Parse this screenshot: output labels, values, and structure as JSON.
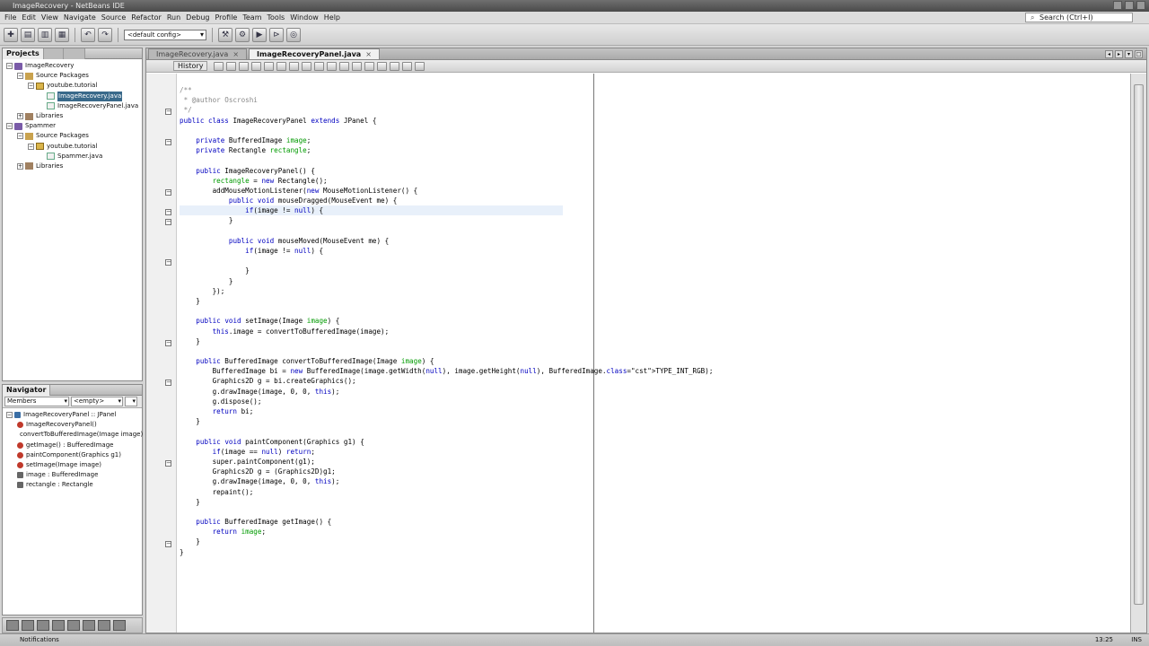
{
  "window": {
    "title": "ImageRecovery - NetBeans IDE"
  },
  "menu": [
    "File",
    "Edit",
    "View",
    "Navigate",
    "Source",
    "Refactor",
    "Run",
    "Debug",
    "Profile",
    "Team",
    "Tools",
    "Window",
    "Help"
  ],
  "search": {
    "placeholder": "Search (Ctrl+I)"
  },
  "toolbar": {
    "config": "<default config>"
  },
  "projects": {
    "tab_label": "Projects",
    "items": [
      {
        "label": "ImageRecovery",
        "type": "project",
        "indent": 0
      },
      {
        "label": "Source Packages",
        "type": "pkgfolder",
        "indent": 1
      },
      {
        "label": "youtube.tutorial",
        "type": "package",
        "indent": 2
      },
      {
        "label": "ImageRecovery.java",
        "type": "java",
        "indent": 3,
        "selected": true
      },
      {
        "label": "ImageRecoveryPanel.java",
        "type": "java",
        "indent": 3
      },
      {
        "label": "Libraries",
        "type": "library",
        "indent": 1
      },
      {
        "label": "Spammer",
        "type": "project",
        "indent": 0
      },
      {
        "label": "Source Packages",
        "type": "pkgfolder",
        "indent": 1
      },
      {
        "label": "youtube.tutorial",
        "type": "package",
        "indent": 2
      },
      {
        "label": "Spammer.java",
        "type": "java",
        "indent": 3
      },
      {
        "label": "Libraries",
        "type": "library",
        "indent": 1
      }
    ]
  },
  "navigator": {
    "tab_label": "Navigator",
    "filter1": "Members",
    "filter2": "<empty>",
    "items": [
      {
        "label": "ImageRecoveryPanel :: JPanel",
        "kind": "class",
        "indent": 0
      },
      {
        "label": "ImageRecoveryPanel()",
        "kind": "method",
        "indent": 1
      },
      {
        "label": "convertToBufferedImage(Image image)",
        "kind": "method",
        "indent": 1
      },
      {
        "label": "getImage() : BufferedImage",
        "kind": "method",
        "indent": 1
      },
      {
        "label": "paintComponent(Graphics g1)",
        "kind": "method",
        "indent": 1
      },
      {
        "label": "setImage(Image image)",
        "kind": "method",
        "indent": 1
      },
      {
        "label": "image : BufferedImage",
        "kind": "field",
        "indent": 1
      },
      {
        "label": "rectangle : Rectangle",
        "kind": "field",
        "indent": 1
      }
    ]
  },
  "editor": {
    "tabs": [
      {
        "label": "ImageRecovery.java",
        "active": false
      },
      {
        "label": "ImageRecoveryPanel.java",
        "active": true
      }
    ],
    "history_label": "History",
    "code_lines": [
      "/**",
      " * @author Oscroshi",
      " */",
      "public class ImageRecoveryPanel extends JPanel {",
      "",
      "    private BufferedImage image;",
      "    private Rectangle rectangle;",
      "",
      "    public ImageRecoveryPanel() {",
      "        rectangle = new Rectangle();",
      "        addMouseMotionListener(new MouseMotionListener() {",
      "            public void mouseDragged(MouseEvent me) {",
      "                if(image != null) {",
      "            }",
      "",
      "            public void mouseMoved(MouseEvent me) {",
      "                if(image != null) {",
      "",
      "                }",
      "            }",
      "        });",
      "    }",
      "",
      "    public void setImage(Image image) {",
      "        this.image = convertToBufferedImage(image);",
      "    }",
      "",
      "    public BufferedImage convertToBufferedImage(Image image) {",
      "        BufferedImage bi = new BufferedImage(image.getWidth(null), image.getHeight(null), BufferedImage.TYPE_INT_RGB);",
      "        Graphics2D g = bi.createGraphics();",
      "        g.drawImage(image, 0, 0, this);",
      "        g.dispose();",
      "        return bi;",
      "    }",
      "",
      "    public void paintComponent(Graphics g1) {",
      "        if(image == null) return;",
      "        super.paintComponent(g1);",
      "        Graphics2D g = (Graphics2D)g1;",
      "        g.drawImage(image, 0, 0, this);",
      "        repaint();",
      "    }",
      "",
      "    public BufferedImage getImage() {",
      "        return image;",
      "    }",
      "}"
    ],
    "current_line": 13
  },
  "status": {
    "notifications": "Notifications",
    "position": "13:25",
    "insert_mode": "INS"
  }
}
